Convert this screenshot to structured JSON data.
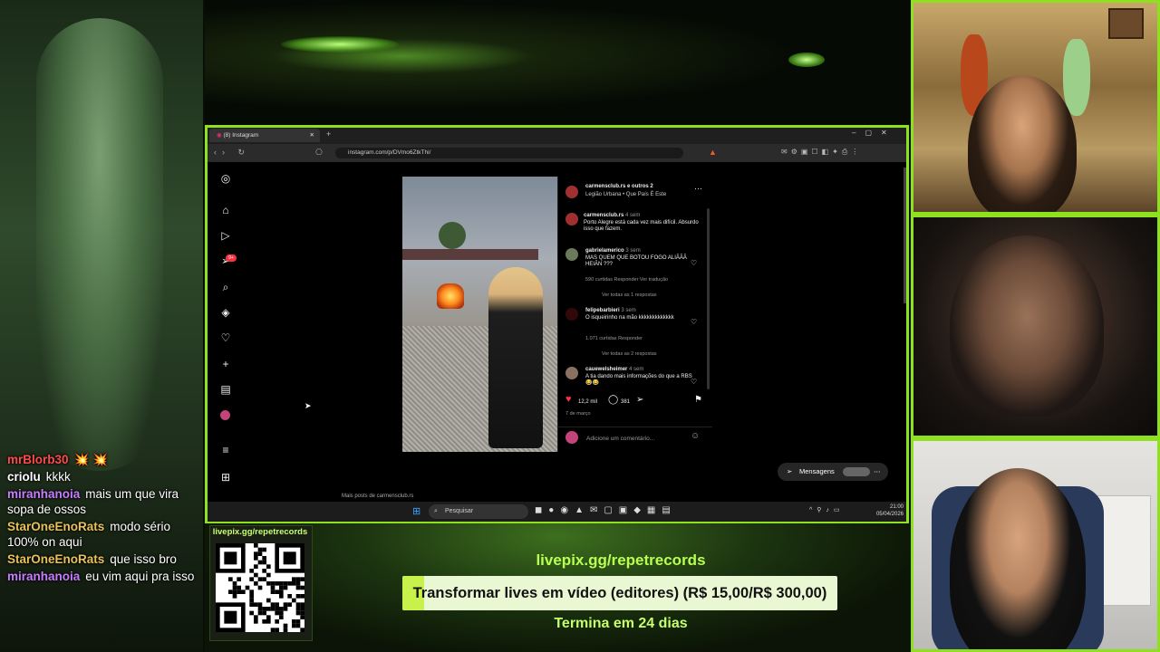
{
  "chat": {
    "messages": [
      {
        "user": "mrBlorb30",
        "text": "💥 💥",
        "color": "#ff4b4b"
      },
      {
        "user": "criolu",
        "text": "kkkk",
        "color": "#ffffff"
      },
      {
        "user": "miranhanoia",
        "text": "mais um que vira sopa de ossos",
        "color": "#c77dff"
      },
      {
        "user": "StarOneEnoRats",
        "text": "modo sério 100% on aqui",
        "color": "#e8c15a"
      },
      {
        "user": "StarOneEnoRats",
        "text": "que isso bro",
        "color": "#e8c15a"
      },
      {
        "user": "miranhanoia",
        "text": "eu vim aqui pra isso",
        "color": "#c77dff"
      }
    ]
  },
  "browser": {
    "tab_title": "(8) Instagram",
    "url": "instagram.com/p/DVmo6ZtkThi/"
  },
  "instagram": {
    "notif_badge": "9+",
    "post_header_user": "carmensclub.rs e outros 2",
    "post_header_song": "Legião Urbana • Que País É Este",
    "comments": [
      {
        "user": "carmensclub.rs",
        "time": "4 sem",
        "text": "Porto Alegre está cada vez mais difícil. Absurdo isso que fazem.",
        "meta": ""
      },
      {
        "user": "gabrielamerico",
        "time": "3 sem",
        "text": "MAS QUEM QUE BOTOU FOGO ALIÃÃÃ HEIÃN ???",
        "meta": "590 curtidas   Responder   Ver tradução",
        "replies": "Ver todas as 1 respostas"
      },
      {
        "user": "felipebarbieri",
        "time": "3 sem",
        "text": "O isqueirinho na mão kkkkkkkkkkkkk",
        "meta": "1.071 curtidas   Responder",
        "replies": "Ver todas as 2 respostas"
      },
      {
        "user": "cauewelsheimer",
        "time": "4 sem",
        "text": "A tia dando mais informações do que a RBS 😂😂",
        "meta": ""
      }
    ],
    "likes": "12,2 mil",
    "comment_count": "381",
    "date": "7 de março",
    "add_comment_placeholder": "Adicione um comentário...",
    "more_posts": "Mais posts de carmensclub.rs",
    "messages_label": "Mensagens"
  },
  "taskbar": {
    "search_placeholder": "Pesquisar",
    "time": "21:00",
    "date": "05/04/2026"
  },
  "banner": {
    "qr_label": "livepix.gg/repetrecords",
    "url": "livepix.gg/repetrecords",
    "goal_text": "Transformar lives em vídeo (editores) (R$ 15,00/R$ 300,00)",
    "goal_progress": 0.05,
    "ends": "Termina em 24 dias"
  }
}
